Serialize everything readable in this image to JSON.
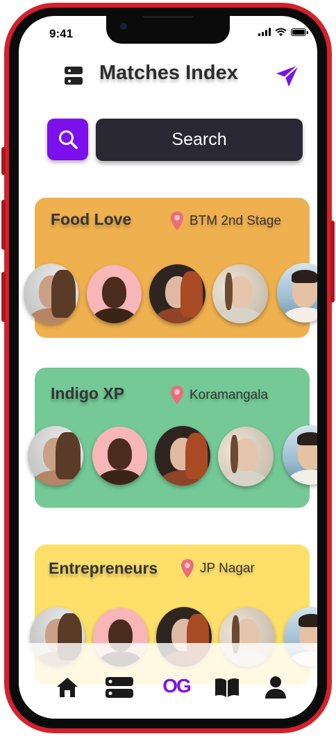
{
  "status_bar": {
    "time": "9:41"
  },
  "header": {
    "title": "Matches Index",
    "menu_icon": "server-stack-icon",
    "send_icon": "paper-plane-icon"
  },
  "search": {
    "label": "Search",
    "icon": "search-icon",
    "accent": "#7b10ec"
  },
  "cards": [
    {
      "title": "Food Love",
      "location": "BTM 2nd Stage",
      "color": "#efb04f"
    },
    {
      "title": "Indigo XP",
      "location": "Koramangala",
      "color": "#74c996"
    },
    {
      "title": "Entrepreneurs",
      "location": "JP Nagar",
      "color": "#fddf6a"
    }
  ],
  "bottom_nav": {
    "items": [
      {
        "icon": "home-icon"
      },
      {
        "icon": "server-stack-icon"
      },
      {
        "icon": "og-logo-icon",
        "label": "OG"
      },
      {
        "icon": "book-icon"
      },
      {
        "icon": "user-icon"
      }
    ]
  }
}
